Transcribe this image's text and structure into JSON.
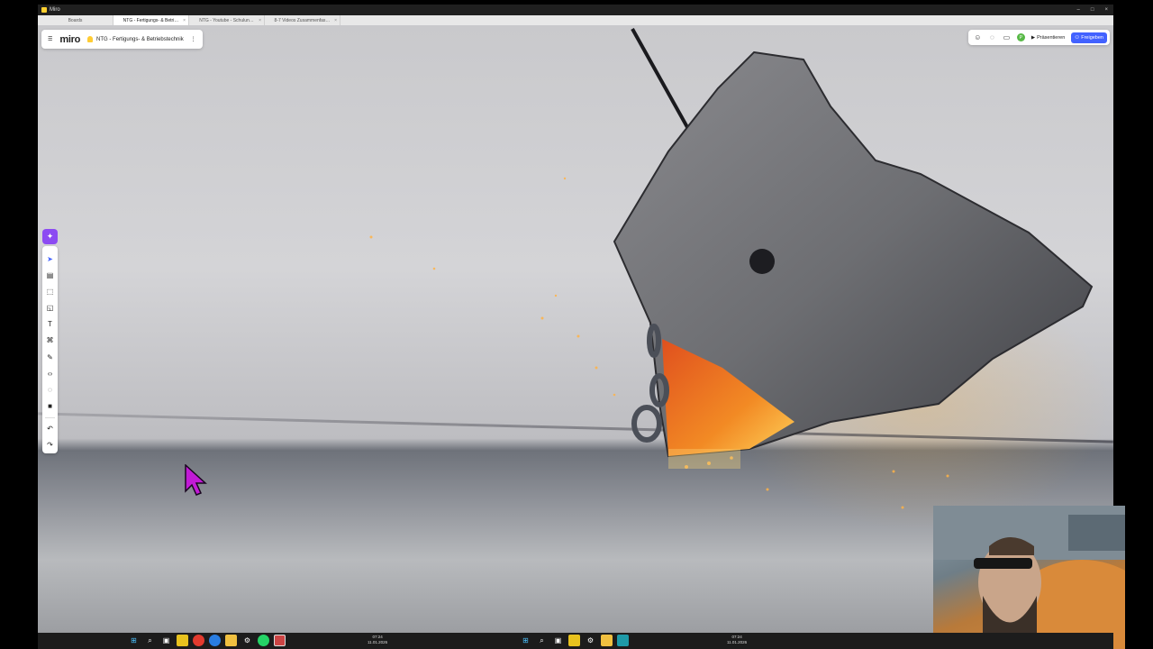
{
  "window": {
    "title": "Miro",
    "controls": [
      "–",
      "□",
      "×"
    ]
  },
  "tabs": [
    {
      "label": "Boards",
      "active": false
    },
    {
      "label": "NTG - Fertigungs- & Betri…",
      "active": true
    },
    {
      "label": "NTG - Youtube - Schulun…",
      "active": false
    },
    {
      "label": "8-7 Videos Zusammenfas…",
      "active": false
    }
  ],
  "board": {
    "brand": "miro",
    "name": "NTG - Fertigungs- & Betriebstechnik"
  },
  "topright": {
    "present_label": "Präsentieren",
    "share_label": "Freigeben",
    "avatar_initial": "P"
  },
  "toolbar_tools": [
    {
      "name": "select-tool",
      "glyph": "➤"
    },
    {
      "name": "templates-tool",
      "glyph": "▤"
    },
    {
      "name": "frame-tool",
      "glyph": "⬚"
    },
    {
      "name": "sticky-note-tool",
      "glyph": "◱"
    },
    {
      "name": "text-tool",
      "glyph": "T"
    },
    {
      "name": "shapes-tool",
      "glyph": "⌘"
    },
    {
      "name": "pen-tool",
      "glyph": "✎"
    },
    {
      "name": "embed-tool",
      "glyph": "‹›"
    },
    {
      "name": "comment-tool",
      "glyph": "◌"
    },
    {
      "name": "apps-tool",
      "glyph": "■"
    }
  ],
  "history_tools": [
    {
      "name": "undo-button",
      "glyph": "↶"
    },
    {
      "name": "redo-button",
      "glyph": "↷"
    }
  ],
  "taskbar": {
    "clock_left": {
      "time": "07:24",
      "date": "11.01.2026"
    },
    "clock_right": {
      "time": "07:24",
      "date": "11.01.2026"
    }
  },
  "colors": {
    "miro_yellow": "#ffd02f",
    "share_blue": "#4262ff",
    "ai_purple": "#8c4bf2",
    "cursor_magenta": "#c21ad6"
  }
}
